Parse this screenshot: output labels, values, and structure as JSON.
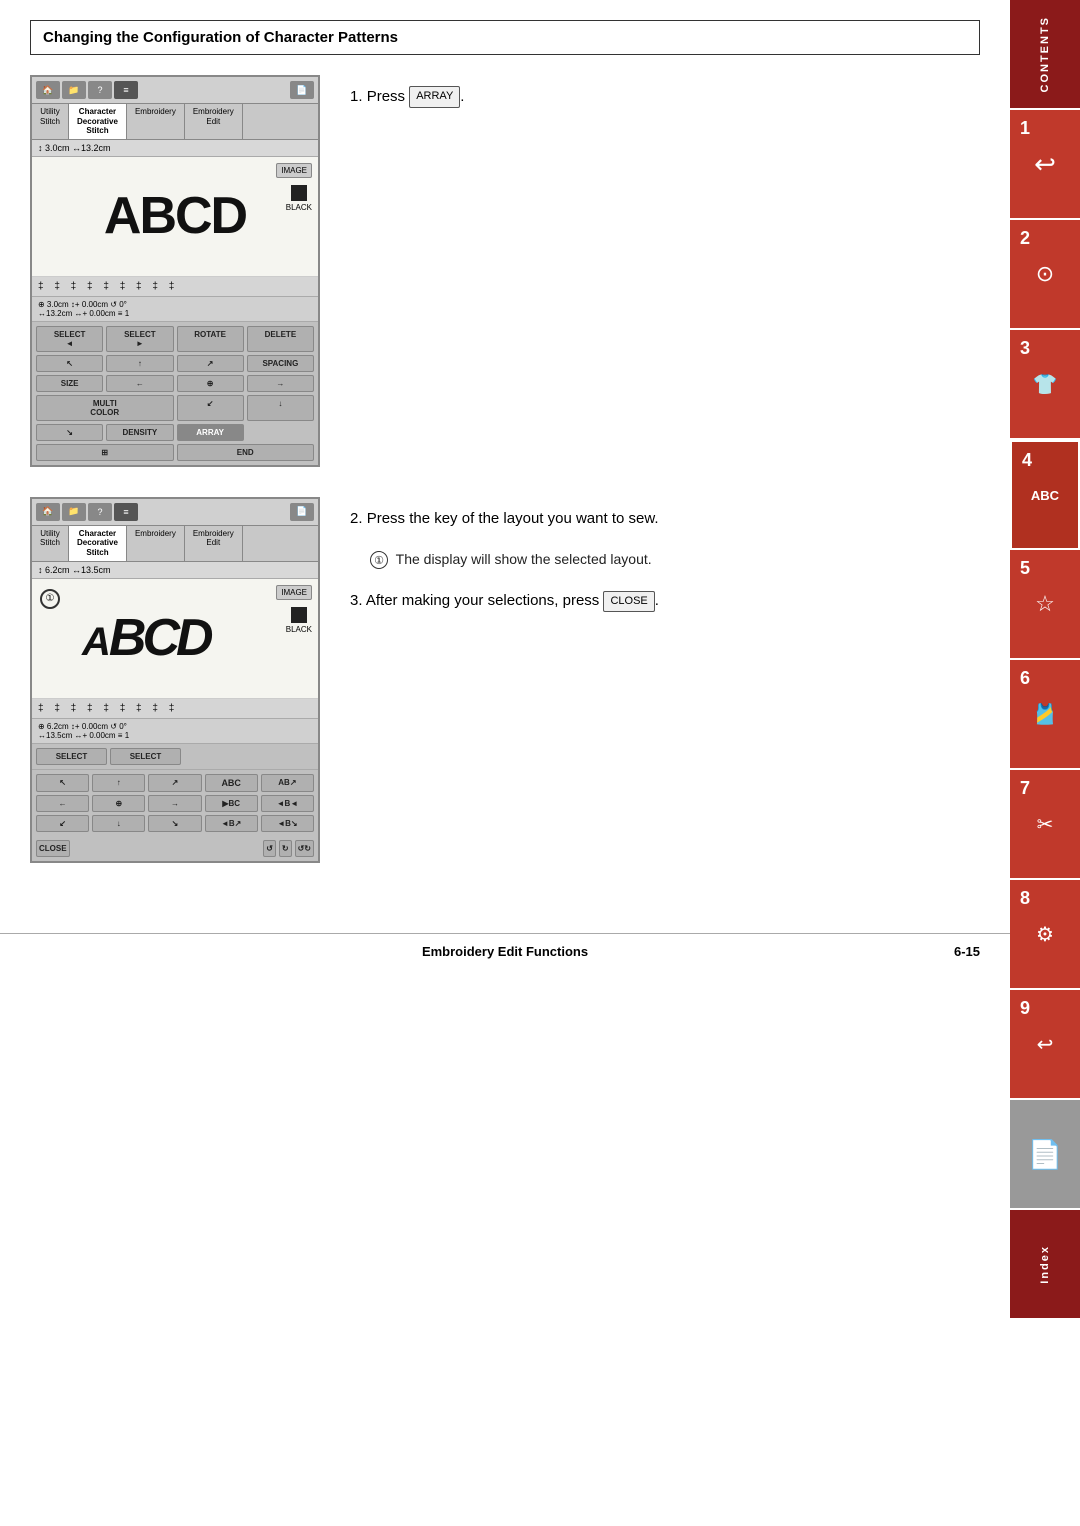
{
  "page": {
    "title": "Changing the Configuration of Character Patterns",
    "footer_center": "Embroidery Edit Functions",
    "footer_right": "6-15"
  },
  "sidebar": {
    "tabs": [
      {
        "id": "contents",
        "label": "CONTENTS",
        "num": "",
        "icon": "≡"
      },
      {
        "id": "1",
        "label": "1",
        "num": "1",
        "icon": "↩"
      },
      {
        "id": "2",
        "label": "2",
        "num": "2",
        "icon": "⊙"
      },
      {
        "id": "3",
        "label": "3",
        "num": "3",
        "icon": "👕"
      },
      {
        "id": "4",
        "label": "4",
        "num": "4",
        "icon": "ABC"
      },
      {
        "id": "5",
        "label": "5",
        "num": "5",
        "icon": "☆"
      },
      {
        "id": "6",
        "label": "6",
        "num": "6",
        "icon": "🎽"
      },
      {
        "id": "7",
        "label": "7",
        "num": "7",
        "icon": "✂"
      },
      {
        "id": "8",
        "label": "8",
        "num": "8",
        "icon": "⚙"
      },
      {
        "id": "9",
        "label": "9",
        "num": "9",
        "icon": "↩"
      },
      {
        "id": "doc",
        "label": "",
        "num": "",
        "icon": "📄"
      },
      {
        "id": "index",
        "label": "Index",
        "num": "",
        "icon": ""
      }
    ]
  },
  "screen1": {
    "tabs": [
      "Utility\nStitch",
      "Character\nDecorative\nStitch",
      "Embroidery",
      "Embroidery\nEdit"
    ],
    "metrics_top": "↕ 3.0cm ↔13.2cm",
    "image_btn": "IMAGE",
    "color_label": "BLACK",
    "display_text": "ABCD",
    "dividers": "‡ ‡ ‡ ‡ ‡ ‡ ‡ ‡ ‡",
    "params": "⊕ 3.0cm ↕+ 0.00cm ↺ 0°\n↔13.2cm ↔+ 0.00cm ≡ 1",
    "buttons": [
      [
        "SELECT ◄",
        "SELECT ►",
        "ROTATE",
        "DELETE"
      ],
      [
        "↖",
        "↑",
        "↗",
        "SPACING",
        "SIZE"
      ],
      [
        "←",
        "↔",
        "→",
        "MULTI COLOR",
        ""
      ],
      [
        "↙",
        "↓",
        "↘",
        "DENSITY",
        "ARRAY"
      ],
      [
        "⊞",
        "",
        "",
        "",
        "END"
      ]
    ]
  },
  "screen2": {
    "tabs": [
      "Utility\nStitch",
      "Character\nDecorative\nStitch",
      "Embroidery",
      "Embroidery\nEdit"
    ],
    "metrics_top": "↕ 6.2cm ↔13.5cm",
    "image_btn": "IMAGE",
    "color_label": "BLACK",
    "display_text": "BCD",
    "circle_label": "①",
    "params": "⊕ 6.2cm ↕+ 0.00cm ↺ 0°\n↔13.5cm ↔+ 0.00cm ≡ 1",
    "buttons": [
      [
        "SELECT",
        "SELECT",
        ""
      ],
      [
        "↖",
        "↑",
        "↗",
        "ABC",
        "AB↗"
      ],
      [
        "←",
        "↔",
        "→",
        "▶BC",
        "◄B◄"
      ],
      [
        "↙",
        "↓",
        "↘",
        "◄B↗",
        "◄B↘"
      ],
      [
        "CLOSE",
        "",
        "↺↻",
        "↺↻"
      ]
    ]
  },
  "steps": [
    {
      "num": "1.",
      "text": "Press ",
      "key": "ARRAY",
      "rest": ""
    },
    {
      "num": "2.",
      "text": "Press the key of the layout you want to sew.",
      "key": "",
      "rest": ""
    },
    {
      "num": "2sub",
      "circle": "①",
      "text": "The display will show the selected layout.",
      "key": "",
      "rest": ""
    },
    {
      "num": "3.",
      "text": "After making your selections, press ",
      "key": "CLOSE",
      "rest": "."
    }
  ]
}
